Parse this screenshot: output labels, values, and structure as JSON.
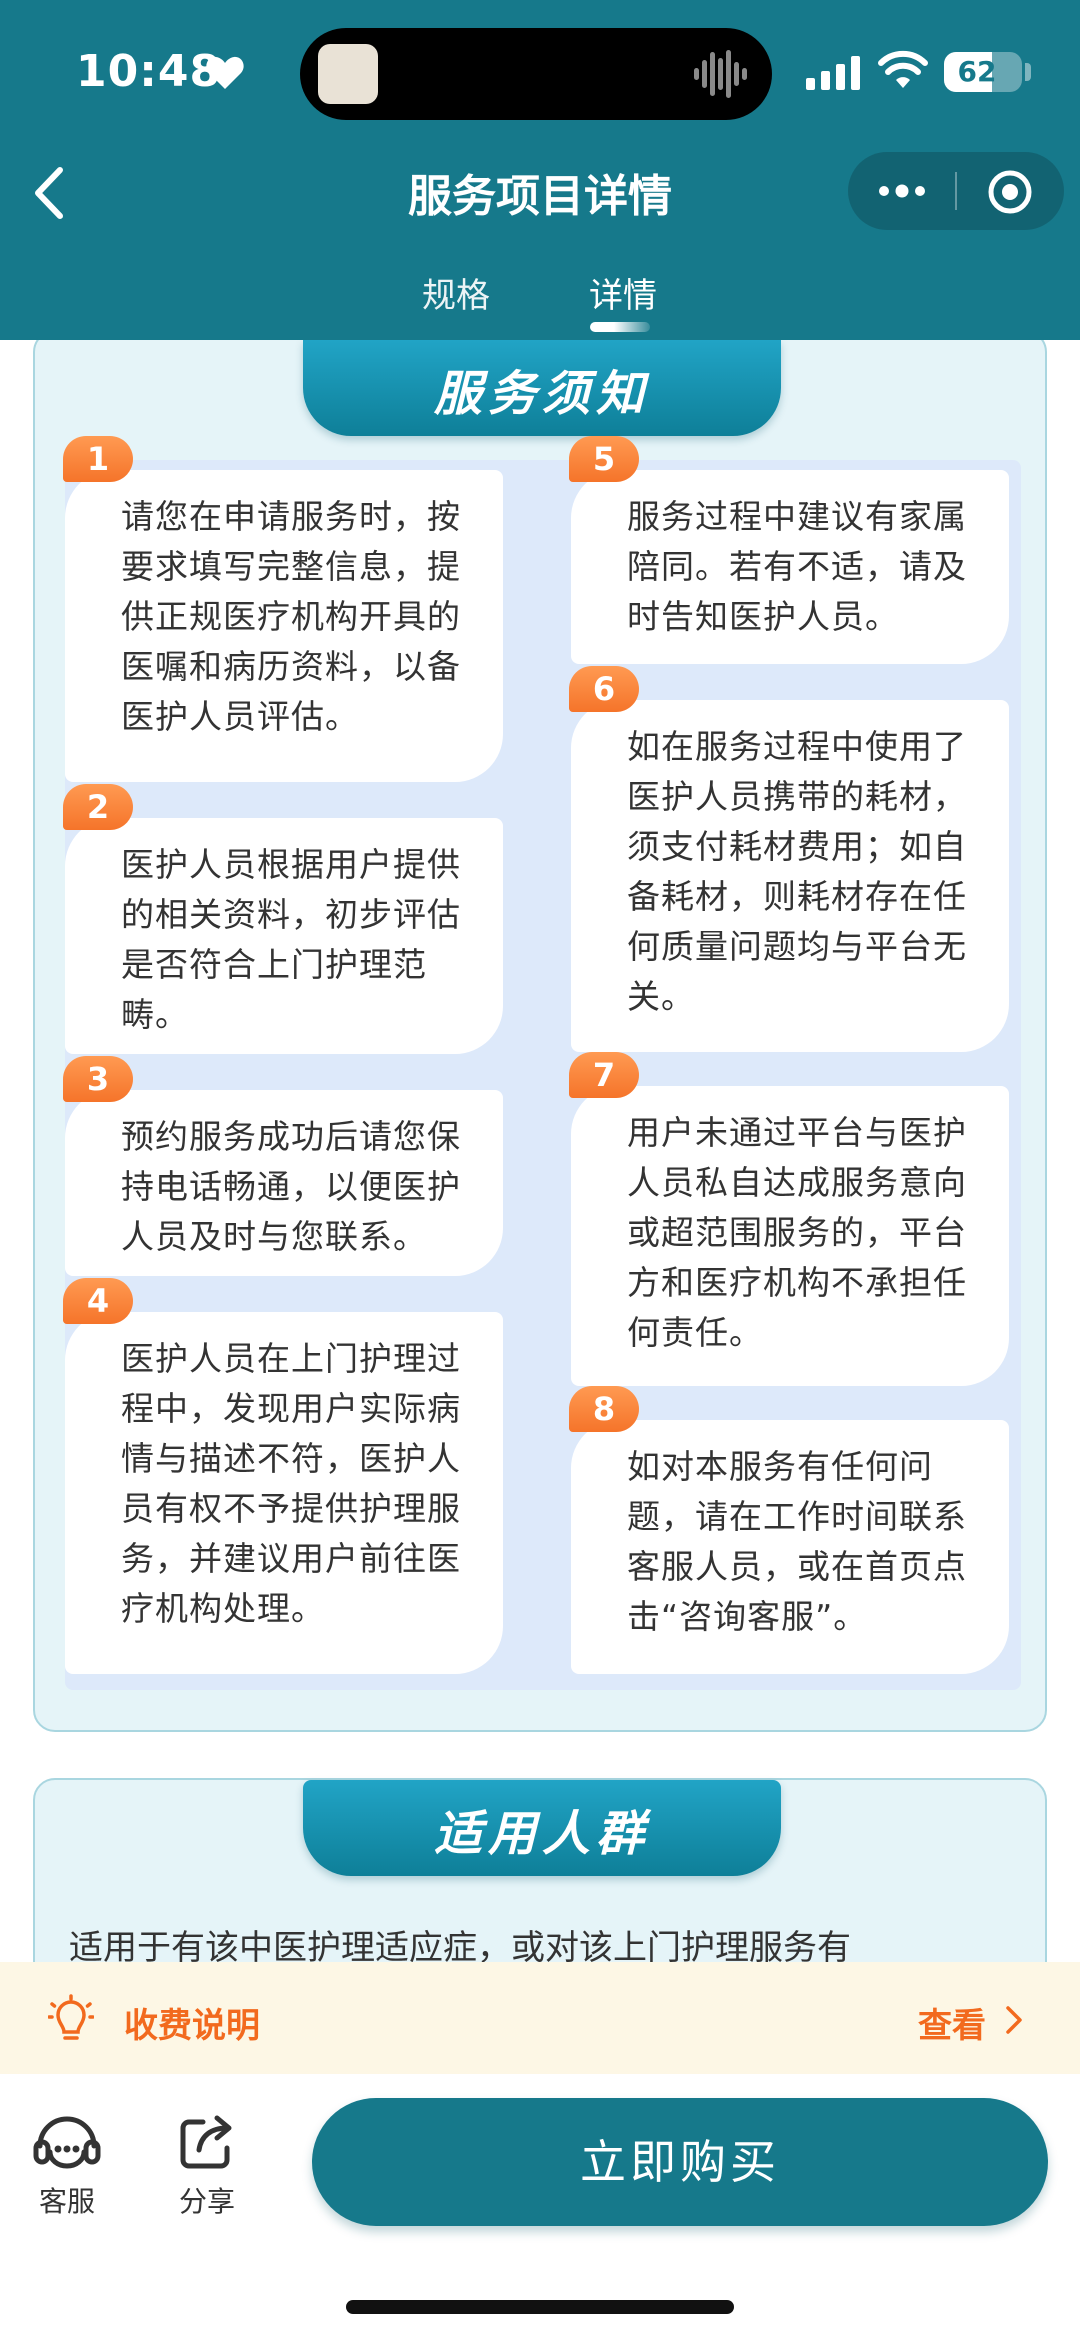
{
  "status_bar": {
    "time": "10:48",
    "battery": "62",
    "battery_level_percent": 62
  },
  "nav": {
    "title": "服务项目详情",
    "back_icon": "chevron-left-icon",
    "more_icon": "more-dots-icon",
    "close_icon": "target-circle-icon"
  },
  "tabs": [
    {
      "label": "规格",
      "active": false
    },
    {
      "label": "详情",
      "active": true
    }
  ],
  "notice": {
    "heading": "服务须知",
    "items": [
      {
        "num": "1",
        "text": "请您在申请服务时，按要求填写完整信息，提供正规医疗机构开具的医嘱和病历资料，以备医护人员评估。"
      },
      {
        "num": "2",
        "text": "医护人员根据用户提供的相关资料，初步评估是否符合上门护理范畴。"
      },
      {
        "num": "3",
        "text": "预约服务成功后请您保持电话畅通，以便医护人员及时与您联系。"
      },
      {
        "num": "4",
        "text": "医护人员在上门护理过程中，发现用户实际病情与描述不符，医护人员有权不予提供护理服务，并建议用户前往医疗机构处理。"
      },
      {
        "num": "5",
        "text": "服务过程中建议有家属陪同。若有不适，请及时告知医护人员。"
      },
      {
        "num": "6",
        "text": "如在服务过程中使用了医护人员携带的耗材，须支付耗材费用；如自备耗材，则耗材存在任何质量问题均与平台无关。"
      },
      {
        "num": "7",
        "text": "用户未通过平台与医护人员私自达成服务意向或超范围服务的，平台方和医疗机构不承担任何责任。"
      },
      {
        "num": "8",
        "text": "如对本服务有任何问题，请在工作时间联系客服人员，或在首页点击“咨询客服”。"
      }
    ]
  },
  "crowd": {
    "heading": "适用人群",
    "text": "适用于有该中医护理适应症，或对该上门护理服务有"
  },
  "fee": {
    "label": "收费说明",
    "link": "查看",
    "icon": "lightbulb-icon"
  },
  "bottom": {
    "service_label": "客服",
    "share_label": "分享",
    "buy_label": "立即购买"
  },
  "colors": {
    "primary": "#16798b",
    "accent_orange": "#f26a1e",
    "card_bg": "#e5f4f8",
    "fee_bg": "#fdf7e5"
  }
}
